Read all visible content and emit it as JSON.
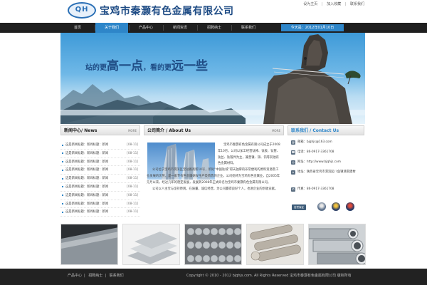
{
  "header": {
    "logo_text": "QH",
    "company_name": "宝鸡市秦灏有色金属有限公司",
    "top_links": [
      "设为主页",
      "加入收藏",
      "联系我们"
    ]
  },
  "nav": {
    "items": [
      "首页",
      "关于我们",
      "产品中心",
      "新闻资讯",
      "招聘纳士",
      "联系我们"
    ],
    "active_index": 1,
    "date_text": "今天是：2012年01月10日"
  },
  "banner": {
    "slogan_part1": "站的更",
    "slogan_big1": "高一点",
    "slogan_part2": "，看的更",
    "slogan_big2": "远一些"
  },
  "news": {
    "title": "新闻中心/ News",
    "more": "MORE",
    "items": [
      {
        "text": "这是新闻标题：新闻标题：新闻",
        "date": "[08-11]"
      },
      {
        "text": "这是新闻标题：新闻标题：新闻",
        "date": "[08-11]"
      },
      {
        "text": "这是新闻标题：新闻标题：新闻",
        "date": "[08-11]"
      },
      {
        "text": "这是新闻标题：新闻标题：新闻",
        "date": "[08-11]"
      },
      {
        "text": "这是新闻标题：新闻标题：新闻",
        "date": "[08-11]"
      },
      {
        "text": "这是新闻标题：新闻标题：新闻",
        "date": "[08-11]"
      },
      {
        "text": "这是新闻标题：新闻标题：新闻",
        "date": "[08-11]"
      },
      {
        "text": "这是新闻标题：新闻标题：新闻",
        "date": "[08-11]"
      },
      {
        "text": "这是新闻标题：新闻标题：新闻",
        "date": "[08-11]"
      }
    ]
  },
  "about": {
    "title": "公司简介 / About Us",
    "more": "MORE",
    "para1": "宝鸡市秦灏有色金属有限公司成立于2008年10月，公司以加工经营钛棒、钛板、钛管、钛丝、钛锻件为主，兼营镍、钼、钨等其他有色金属材料。",
    "para2": "公司位于宝鸡市渭滨区宝钛路高新10号，所处“中国钛城”得天独厚的非常便利的原料资源及工业发展的优势，是一家专有色金属研发生产及销售的企业。公司始终为宝鸡有色金属业，自2005年元月以来，经过几年的稳定发展，发展到2008年正式命名为宝鸡市秦灏有色金属有限公司。",
    "para3": "公司以人主宝与坚持原则，在质量，诚信经营，为公司赢得良好个人，也进企业的创收贡献。"
  },
  "contact": {
    "title": "联系我们 / Contact Us",
    "items": [
      {
        "icon": "mail-icon",
        "glyph": "@",
        "text": "邮箱：bjqhjs@163.com"
      },
      {
        "icon": "phone-icon",
        "glyph": "☎",
        "text": "电话：86-0917-3361708"
      },
      {
        "icon": "globe-icon",
        "glyph": "◎",
        "text": "网址：http://www.bjqhjs.com"
      },
      {
        "icon": "home-icon",
        "glyph": "⌂",
        "text": "地址：陕西省宝鸡市渭滨区八鱼镇清南建材"
      },
      {
        "icon": "fax-icon",
        "glyph": "✆",
        "text": "传真：86-0917-3361708"
      }
    ],
    "badge_label": "信誉保证"
  },
  "products": [
    {
      "name": "titanium-sheet"
    },
    {
      "name": "titanium-plate"
    },
    {
      "name": "titanium-rods"
    },
    {
      "name": "titanium-bars"
    },
    {
      "name": "titanium-tubes"
    }
  ],
  "footer": {
    "links": [
      "产品中心",
      "招聘纳士",
      "联系我们"
    ],
    "copyright": "Copyright © 2010 - 2012 bjqhjs.com. All Rights Reserved 宝鸡市秦灏有色金属有限公司 版权所有"
  },
  "colors": {
    "accent": "#2e86c9",
    "nav_bg": "#1f1f1f",
    "brand_blue": "#1f4c85"
  }
}
